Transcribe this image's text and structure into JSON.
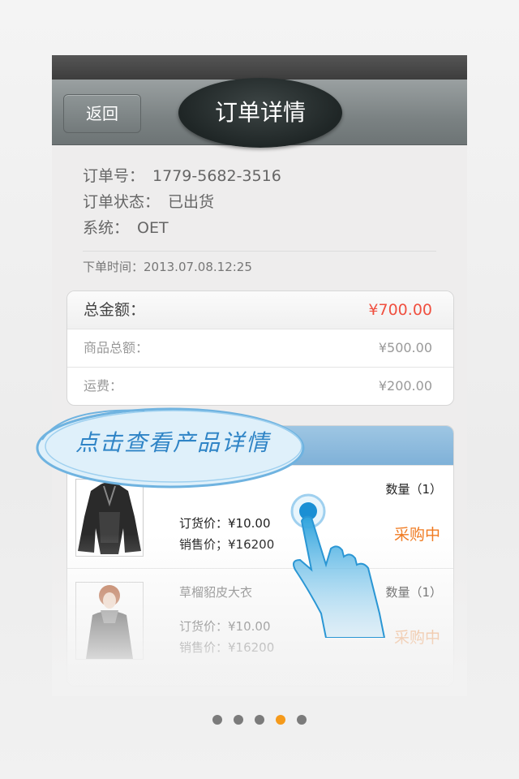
{
  "navbar": {
    "back_label": "返回",
    "title": "订单详情"
  },
  "order": {
    "number_label": "订单号：",
    "number_value": "1779-5682-3516",
    "status_label": "订单状态：",
    "status_value": "已出货",
    "system_label": "系统：",
    "system_value": "OET",
    "time": "下单时间：2013.07.08.12:25"
  },
  "amounts": {
    "total_label": "总金额：",
    "total_value": "¥700.00",
    "goods_label": "商品总额：",
    "goods_value": "¥500.00",
    "shipping_label": "运费：",
    "shipping_value": "¥200.00"
  },
  "callout": {
    "text": "点击查看产品详情"
  },
  "products": [
    {
      "name": "",
      "quantity": "数量（1）",
      "order_price": "订货价：¥10.00",
      "sale_price": "销售价；¥16200",
      "status": "采购中"
    },
    {
      "name": "草榴貂皮大衣",
      "quantity": "数量（1）",
      "order_price": "订货价：¥10.00",
      "sale_price": "销售价：¥16200",
      "status": "采购中"
    }
  ],
  "pagination": {
    "count": 5,
    "active_index": 3
  },
  "colors": {
    "accent": "#f59a1b",
    "price_red": "#f05040",
    "status_orange": "#f07a20",
    "callout_blue": "#2f84c6"
  }
}
